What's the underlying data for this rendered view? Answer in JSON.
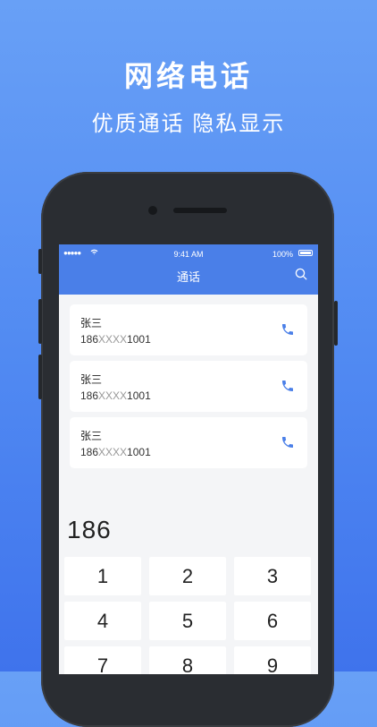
{
  "promo": {
    "headline": "网络电话",
    "subline": "优质通话 隐私显示"
  },
  "status_bar": {
    "signal": "●●●●●",
    "time": "9:41 AM",
    "battery": "100%"
  },
  "app": {
    "title": "通话",
    "accent_color": "#4A7FE8"
  },
  "contacts": [
    {
      "name": "张三",
      "number_prefix": "186",
      "number_mask": "XXXX",
      "number_suffix": "1001"
    },
    {
      "name": "张三",
      "number_prefix": "186",
      "number_mask": "XXXX",
      "number_suffix": "1001"
    },
    {
      "name": "张三",
      "number_prefix": "186",
      "number_mask": "XXXX",
      "number_suffix": "1001"
    }
  ],
  "dialer": {
    "input": "186",
    "keys": [
      "1",
      "2",
      "3",
      "4",
      "5",
      "6",
      "7",
      "8",
      "9"
    ]
  }
}
